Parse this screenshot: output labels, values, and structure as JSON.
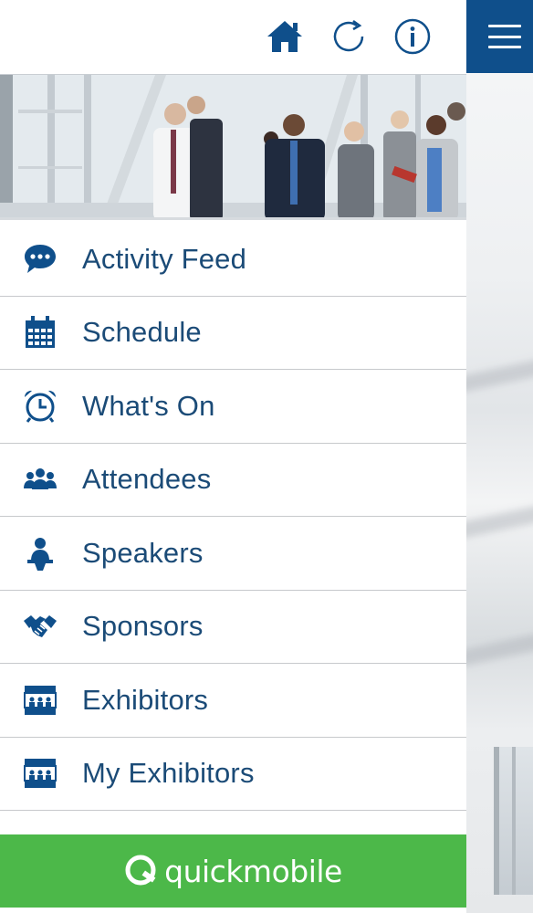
{
  "colors": {
    "brand_blue": "#0f4f8b",
    "menu_text": "#1b4b77",
    "footer_green": "#4cb849",
    "divider": "#c7c9cc"
  },
  "topbar": {
    "icons": [
      "home-icon",
      "refresh-icon",
      "info-icon"
    ]
  },
  "hero": {
    "image": "business-people-walking-photo"
  },
  "menu": {
    "items": [
      {
        "label": "Activity Feed",
        "icon": "speech-bubble-icon"
      },
      {
        "label": "Schedule",
        "icon": "calendar-icon"
      },
      {
        "label": "What's On",
        "icon": "alarm-clock-icon"
      },
      {
        "label": "Attendees",
        "icon": "group-icon"
      },
      {
        "label": "Speakers",
        "icon": "speaker-icon"
      },
      {
        "label": "Sponsors",
        "icon": "handshake-icon"
      },
      {
        "label": "Exhibitors",
        "icon": "booth-icon"
      },
      {
        "label": "My Exhibitors",
        "icon": "booth-icon"
      }
    ]
  },
  "footer": {
    "brand": "quickmobile"
  },
  "background": {
    "header_icon": "hamburger-menu-icon"
  }
}
